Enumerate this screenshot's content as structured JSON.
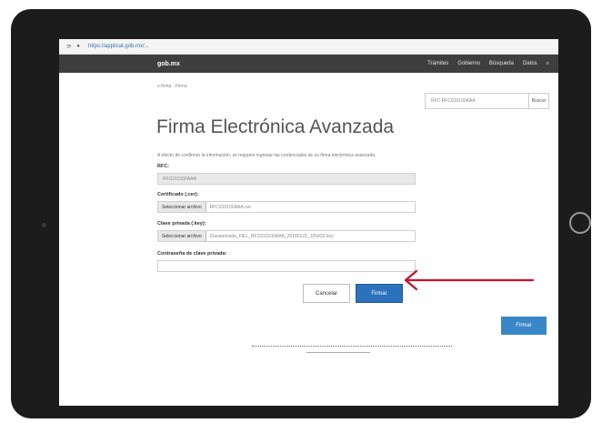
{
  "browser": {
    "url": "https://applicat.gob.mx/...",
    "back_icon": "circle-arrow-icon",
    "lock_icon": "lock-icon"
  },
  "gob": {
    "brand": "gob.mx",
    "nav": [
      "Trámites",
      "Gobierno",
      "Búsqueda",
      "Datos"
    ],
    "search_icon": "search-icon"
  },
  "breadcrumb": "e.firma · Firma",
  "search": {
    "placeholder": "RFC RFC010100AAA",
    "button": "Buscar"
  },
  "title": "Firma Electrónica Avanzada",
  "intro": "A efecto de confirmar la información, se requiere ingresar las credenciales de su firma electrónica avanzada.",
  "form": {
    "rfc_label": "RFC:",
    "rfc_value": "RFC010100AAA",
    "cert_label": "Certificado (.cer):",
    "cert_button": "Seleccionar archivo",
    "cert_file": "RFC010100AAA.cer",
    "key_label": "Clave privada (.key):",
    "key_button": "Seleccionar archivo",
    "key_file": "Claveprivada_FIEL_RFC010100AAA_20180122_105432.key",
    "password_label": "Contraseña de clave privada:"
  },
  "buttons": {
    "cancel": "Cancelar",
    "sign": "Firmar",
    "sign_secondary": "Firmar"
  },
  "colors": {
    "accent": "#2b72bd",
    "arrow": "#c8102e",
    "gob_bar": "#3e3e3e"
  }
}
